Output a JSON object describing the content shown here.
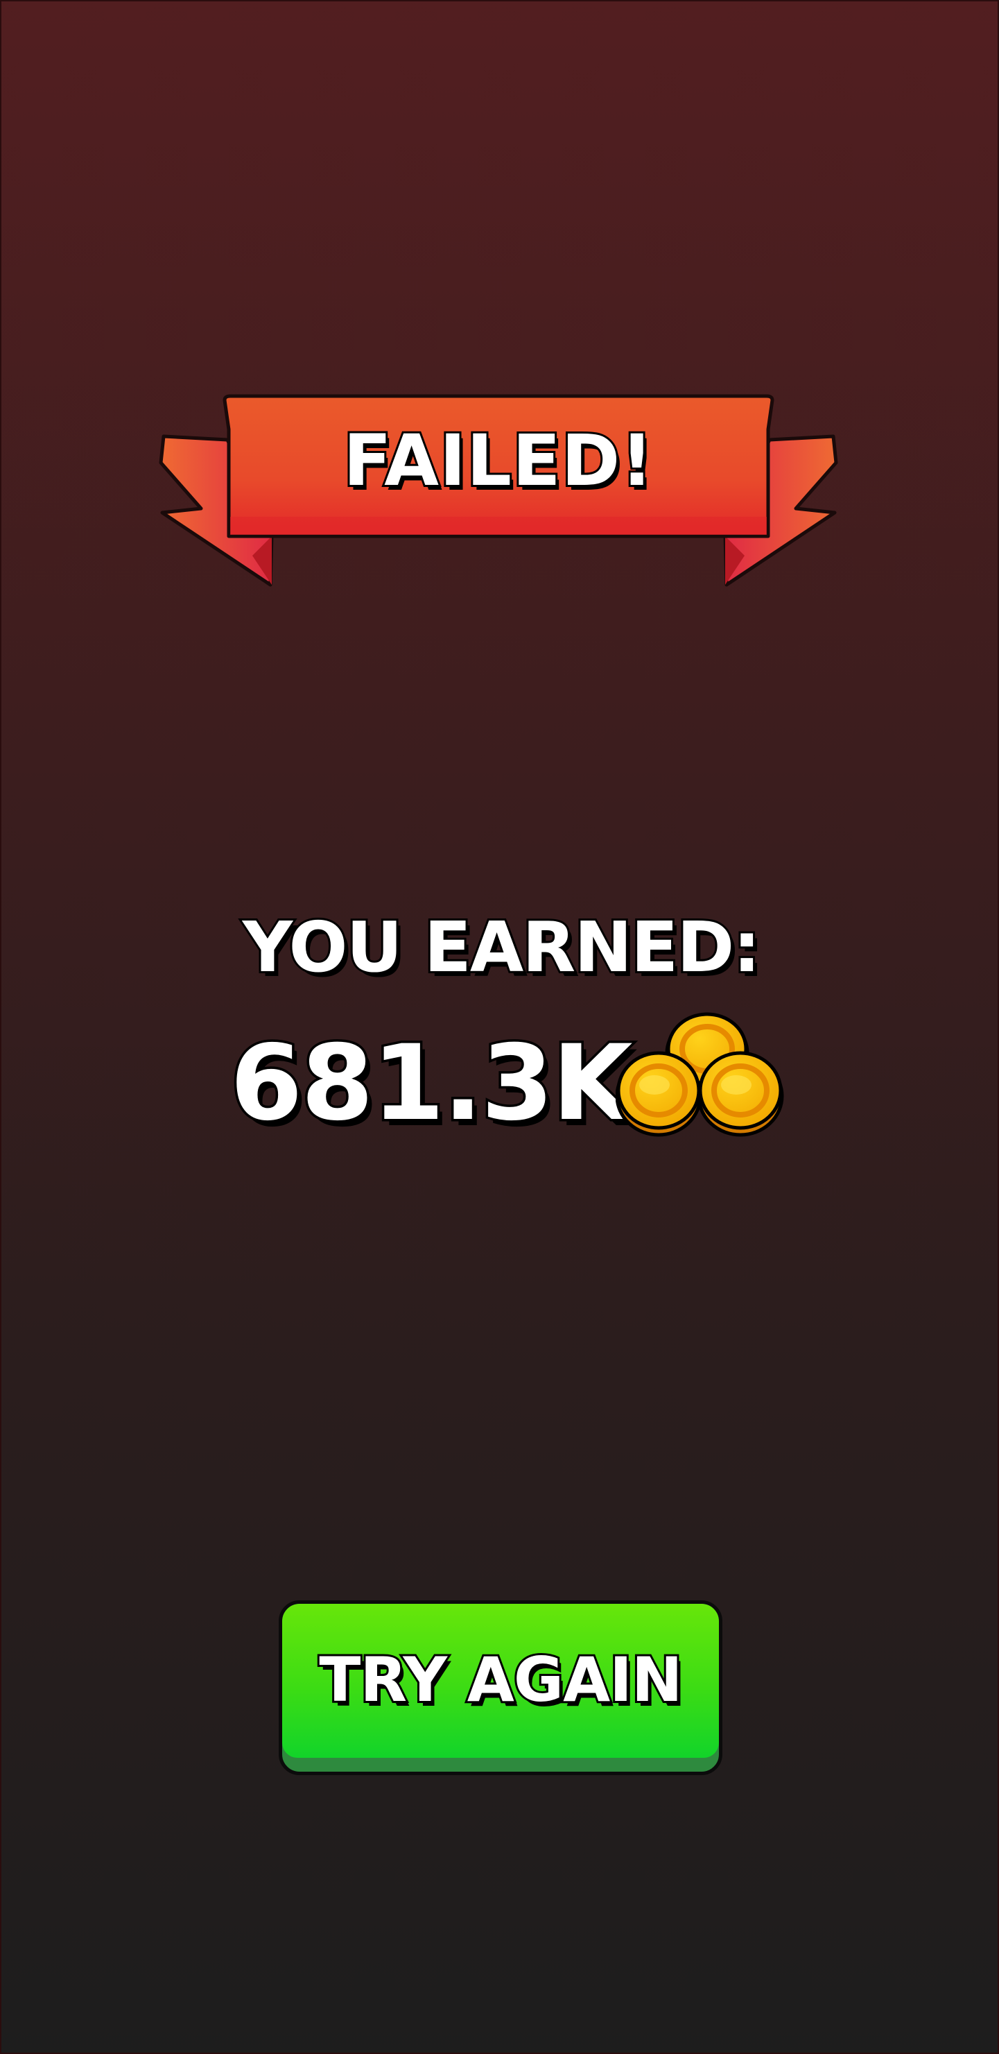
{
  "result_banner": {
    "title": "FAILED!",
    "colors": {
      "ribbon_top": "#e9582c",
      "ribbon_bottom": "#e6322a",
      "ribbon_tail": "#e23a45"
    }
  },
  "reward": {
    "label": "YOU EARNED:",
    "amount": "681.3K",
    "currency_icon": "gold-coins-icon",
    "coin_color": "#f5b800"
  },
  "actions": {
    "try_again_label": "TRY AGAIN",
    "button_color": "#3cdc14"
  },
  "background": {
    "top_color": "#521e20",
    "bottom_color": "#1d1d1d"
  }
}
